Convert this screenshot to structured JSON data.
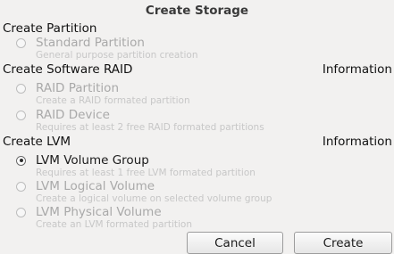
{
  "dialog": {
    "title": "Create Storage"
  },
  "partition": {
    "header": "Create Partition",
    "options": [
      {
        "label": "Standard Partition",
        "description": "General purpose partition creation",
        "selected": false,
        "enabled": false
      }
    ]
  },
  "raid": {
    "header": "Create Software RAID",
    "info_label": "Information",
    "options": [
      {
        "label": "RAID Partition",
        "description": "Create a RAID formated partition",
        "selected": false,
        "enabled": false
      },
      {
        "label": "RAID Device",
        "description": "Requires at least 2 free RAID formated partitions",
        "selected": false,
        "enabled": false
      }
    ]
  },
  "lvm": {
    "header": "Create LVM",
    "info_label": "Information",
    "options": [
      {
        "label": "LVM Volume Group",
        "description": "Requires at least 1 free LVM formated partition",
        "selected": true,
        "enabled": true
      },
      {
        "label": "LVM Logical Volume",
        "description": "Create a logical volume on selected volume group",
        "selected": false,
        "enabled": false
      },
      {
        "label": "LVM Physical Volume",
        "description": "Create an LVM formated partition",
        "selected": false,
        "enabled": false
      }
    ]
  },
  "buttons": {
    "cancel": "Cancel",
    "create": "Create"
  }
}
